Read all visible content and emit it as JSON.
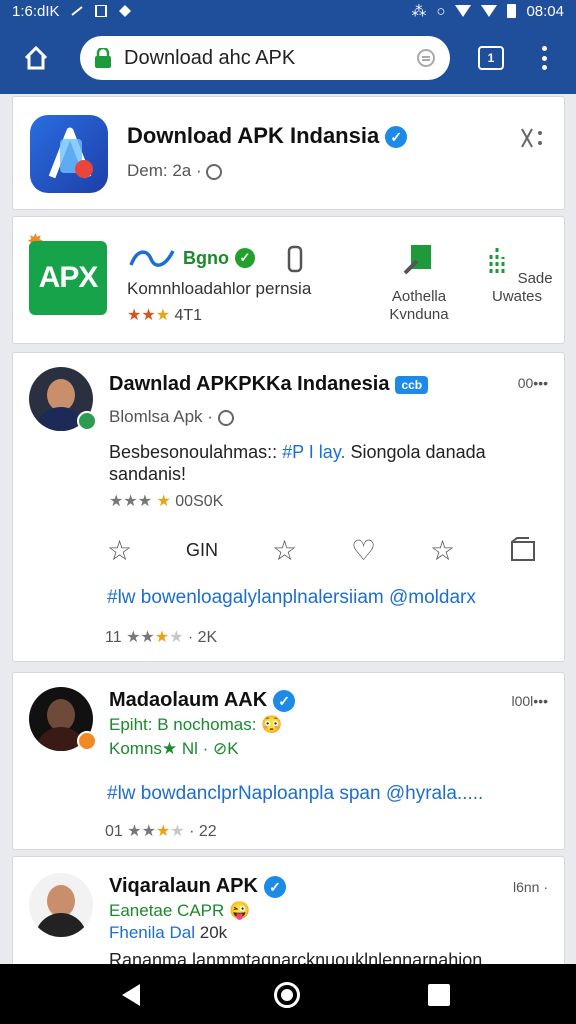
{
  "status_bar": {
    "time_left": "1:6:dIK",
    "time_right": "08:04"
  },
  "browser": {
    "url": "Download ahc APK",
    "tab_count": "1"
  },
  "app_card": {
    "title": "Download APK Indansia",
    "subtitle": "Dem: 2a"
  },
  "featured_card": {
    "logo_text": "APX",
    "name": "Bgno",
    "description": "Komnhloadahlor pernsia",
    "rating": "4Τ1",
    "actions": [
      {
        "line1": "Aothella",
        "line2": "Kvnduna"
      },
      {
        "line1": "Sade",
        "line2": "Uwates"
      }
    ]
  },
  "posts": [
    {
      "title": "Dawnlad APKPKKa Indanesia",
      "badge": "ccb",
      "meta": "00•••",
      "subtitle": "Blomlsa Apk",
      "body_text": "Besbesonoulahmas:: ",
      "body_tag": "#P  I lay.",
      "body_rest": " Siongola danada sandanis!",
      "rating": "00S0K",
      "action_label": "GIN",
      "hashtags": "#lw bowenloagalylanplnalersiiam @moldarx",
      "count_prefix": "11",
      "count": "2K"
    },
    {
      "title": "Madaolaum AAK",
      "meta": "l00l•••",
      "line2": "Epiht: B nochomas: 😳",
      "line3": "Komns★ Nl · ⊘K",
      "hashtags": "#lw bowdanclprNaploanpla span @hyrala.....",
      "count_prefix": "01",
      "count": "22"
    },
    {
      "title": "Viqaralaun APK",
      "meta": "l6nn ·",
      "line2": "Eanetae CAPR 😜",
      "line3": "Fhenila Dal",
      "line3_count": "20k",
      "body": "Rananma.lanmmtaqnarcknuouklnlennarnahion"
    }
  ],
  "colors": {
    "brand_blue": "#1f4f9a",
    "link_blue": "#1b6fd1",
    "green": "#1a8a2b",
    "star": "#e8a317"
  }
}
